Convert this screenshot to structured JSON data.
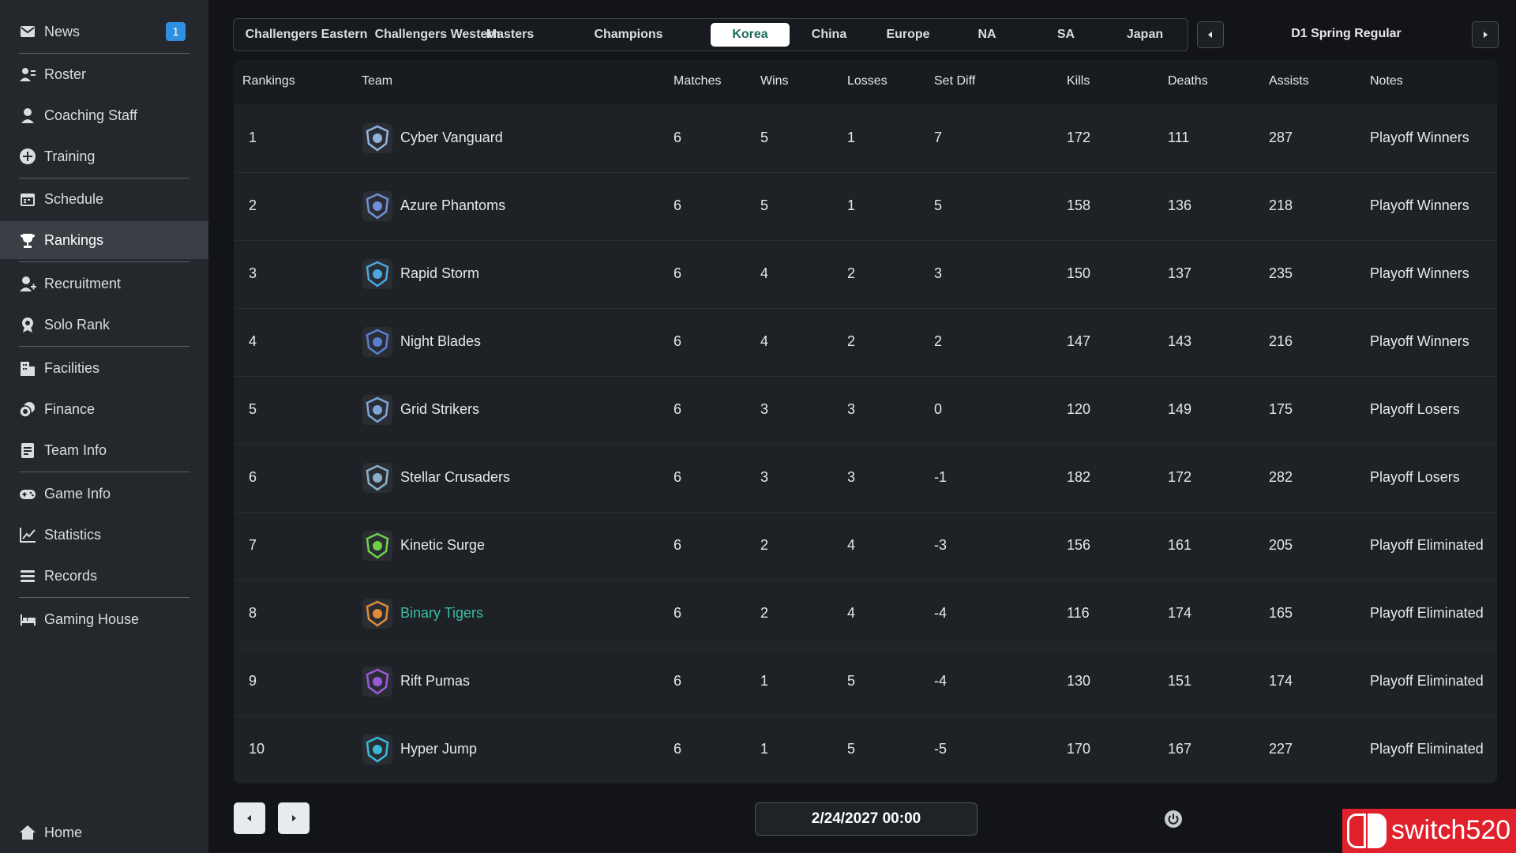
{
  "sidebar": {
    "items": [
      {
        "label": "News",
        "icon": "mail-icon",
        "badge": "1"
      },
      {
        "label": "Roster",
        "icon": "roster-icon"
      },
      {
        "label": "Coaching Staff",
        "icon": "coach-icon"
      },
      {
        "label": "Training",
        "icon": "training-icon"
      },
      {
        "label": "Schedule",
        "icon": "calendar-icon"
      },
      {
        "label": "Rankings",
        "icon": "trophy-icon",
        "active": true
      },
      {
        "label": "Recruitment",
        "icon": "add-person-icon"
      },
      {
        "label": "Solo Rank",
        "icon": "medal-icon"
      },
      {
        "label": "Facilities",
        "icon": "building-icon"
      },
      {
        "label": "Finance",
        "icon": "coins-icon"
      },
      {
        "label": "Team Info",
        "icon": "document-icon"
      },
      {
        "label": "Game Info",
        "icon": "gamepad-icon"
      },
      {
        "label": "Statistics",
        "icon": "chart-icon"
      },
      {
        "label": "Records",
        "icon": "list-icon"
      },
      {
        "label": "Gaming House",
        "icon": "bed-icon"
      }
    ],
    "home_label": "Home"
  },
  "tabs": [
    "Challengers Eastern",
    "Challengers Western",
    "Masters",
    "Champions",
    "Korea",
    "China",
    "Europe",
    "NA",
    "SA",
    "Japan"
  ],
  "active_tab": "Korea",
  "season_label": "D1 Spring Regular",
  "table": {
    "headers": {
      "rank": "Rankings",
      "team": "Team",
      "matches": "Matches",
      "wins": "Wins",
      "losses": "Losses",
      "set_diff": "Set Diff",
      "kills": "Kills",
      "deaths": "Deaths",
      "assists": "Assists",
      "notes": "Notes"
    },
    "rows": [
      {
        "rank": "1",
        "team": "Cyber Vanguard",
        "matches": "6",
        "wins": "5",
        "losses": "1",
        "set_diff": "7",
        "kills": "172",
        "deaths": "111",
        "assists": "287",
        "notes": "Playoff Winners",
        "logo_color": "#8fb3d9"
      },
      {
        "rank": "2",
        "team": "Azure Phantoms",
        "matches": "6",
        "wins": "5",
        "losses": "1",
        "set_diff": "5",
        "kills": "158",
        "deaths": "136",
        "assists": "218",
        "notes": "Playoff Winners",
        "logo_color": "#6f8fd8"
      },
      {
        "rank": "3",
        "team": "Rapid Storm",
        "matches": "6",
        "wins": "4",
        "losses": "2",
        "set_diff": "3",
        "kills": "150",
        "deaths": "137",
        "assists": "235",
        "notes": "Playoff Winners",
        "logo_color": "#4aa6e0"
      },
      {
        "rank": "4",
        "team": "Night Blades",
        "matches": "6",
        "wins": "4",
        "losses": "2",
        "set_diff": "2",
        "kills": "147",
        "deaths": "143",
        "assists": "216",
        "notes": "Playoff Winners",
        "logo_color": "#5a7fd0"
      },
      {
        "rank": "5",
        "team": "Grid Strikers",
        "matches": "6",
        "wins": "3",
        "losses": "3",
        "set_diff": "0",
        "kills": "120",
        "deaths": "149",
        "assists": "175",
        "notes": "Playoff Losers",
        "logo_color": "#7ea4d8"
      },
      {
        "rank": "6",
        "team": "Stellar Crusaders",
        "matches": "6",
        "wins": "3",
        "losses": "3",
        "set_diff": "-1",
        "kills": "182",
        "deaths": "172",
        "assists": "282",
        "notes": "Playoff Losers",
        "logo_color": "#8ab0c8"
      },
      {
        "rank": "7",
        "team": "Kinetic Surge",
        "matches": "6",
        "wins": "2",
        "losses": "4",
        "set_diff": "-3",
        "kills": "156",
        "deaths": "161",
        "assists": "205",
        "notes": "Playoff Eliminated",
        "logo_color": "#6fd04a"
      },
      {
        "rank": "8",
        "team": "Binary Tigers",
        "matches": "6",
        "wins": "2",
        "losses": "4",
        "set_diff": "-4",
        "kills": "116",
        "deaths": "174",
        "assists": "165",
        "notes": "Playoff Eliminated",
        "logo_color": "#e08a3a",
        "highlight": true
      },
      {
        "rank": "9",
        "team": "Rift Pumas",
        "matches": "6",
        "wins": "1",
        "losses": "5",
        "set_diff": "-4",
        "kills": "130",
        "deaths": "151",
        "assists": "174",
        "notes": "Playoff Eliminated",
        "logo_color": "#9a5ad8"
      },
      {
        "rank": "10",
        "team": "Hyper Jump",
        "matches": "6",
        "wins": "1",
        "losses": "5",
        "set_diff": "-5",
        "kills": "170",
        "deaths": "167",
        "assists": "227",
        "notes": "Playoff Eliminated",
        "logo_color": "#3ab8d8"
      }
    ]
  },
  "footer": {
    "date": "2/24/2027 00:00"
  },
  "watermark": "switch520",
  "colors": {
    "accent": "#3bbfa0",
    "badge": "#2f8fe0",
    "watermark_red": "#e0202a"
  }
}
